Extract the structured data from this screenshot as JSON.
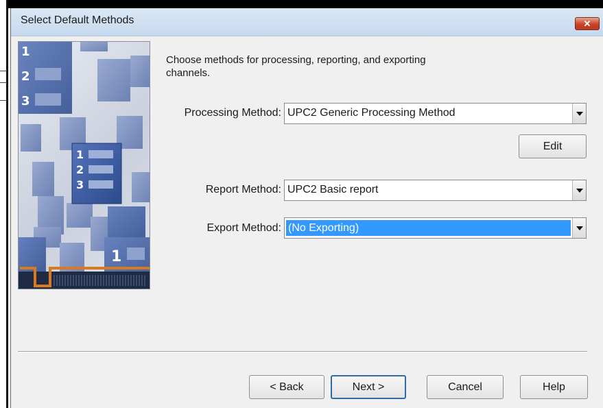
{
  "window": {
    "title": "Select Default Methods",
    "close_label": "x"
  },
  "intro_text": "Choose methods for processing, reporting, and exporting channels.",
  "processing": {
    "label": "Processing Method:",
    "value": "UPC2 Generic Processing Method"
  },
  "edit_button": "Edit",
  "report": {
    "label": "Report Method:",
    "value": "UPC2 Basic report"
  },
  "export": {
    "label": "Export Method:",
    "value": "(No Exporting)"
  },
  "footer": {
    "back": "< Back",
    "next": "Next >",
    "cancel": "Cancel",
    "help": "Help"
  },
  "illustration": {
    "numbers": [
      "1",
      "2",
      "3"
    ]
  },
  "colors": {
    "selection": "#3399ff",
    "close_button": "#c7432a",
    "titlebar": "#c6d9ee",
    "document_blue": "#3f5fa6"
  }
}
